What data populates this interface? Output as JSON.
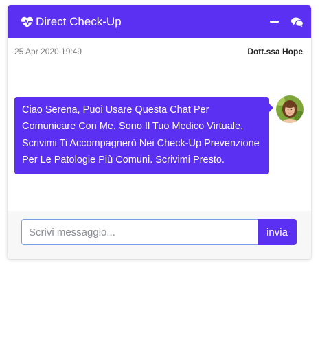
{
  "header": {
    "title": "Direct Check-Up",
    "icons": {
      "title_icon": "heartbeat-icon",
      "minimize_icon": "minimize-icon",
      "chat_icon": "comments-icon"
    }
  },
  "message": {
    "timestamp": "25 Apr 2020 19:49",
    "author": "Dott.ssa Hope",
    "text": "Ciao Serena, Puoi Usare Questa Chat Per Comunicare Con Me, Sono Il Tuo Medico Virtuale, Scrivimi Ti Accompagnerò Nei Check-Up Prevenzione Per Le Patologie Più Comuni. Scrivimi Presto.",
    "avatar_icon": "doctor-avatar"
  },
  "footer": {
    "input_placeholder": "Scrivi messaggio...",
    "input_value": "",
    "send_label": "invia"
  },
  "colors": {
    "accent": "#5b30f2",
    "footer_bg": "#f7f7f7",
    "input_border": "#7a9ee6"
  }
}
